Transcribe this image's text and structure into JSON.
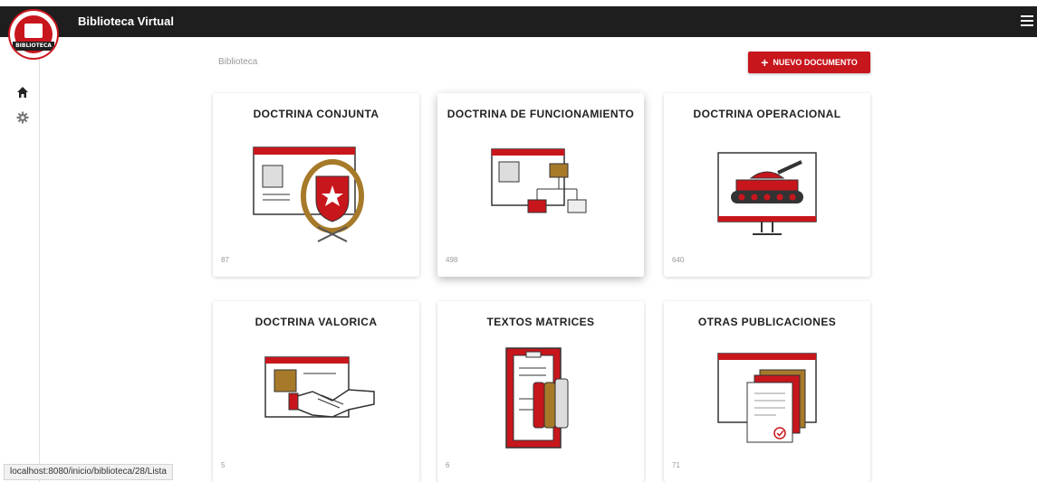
{
  "app": {
    "title": "Biblioteca Virtual",
    "logo_text": "BIBLIOTECA"
  },
  "breadcrumb": "Biblioteca",
  "new_button": {
    "label": "NUEVO DOCUMENTO",
    "icon": "plus-icon"
  },
  "sidebar": {
    "items": [
      {
        "icon": "home-icon"
      },
      {
        "icon": "gear-icon"
      }
    ]
  },
  "status_url": "localhost:8080/inicio/biblioteca/28/Lista",
  "cards": [
    {
      "title": "DOCTRINA CONJUNTA",
      "count": "87",
      "illustration": "seal-document"
    },
    {
      "title": "DOCTRINA DE FUNCIONAMIENTO",
      "count": "498",
      "illustration": "org-chart-document"
    },
    {
      "title": "DOCTRINA OPERACIONAL",
      "count": "640",
      "illustration": "tank-monitor"
    },
    {
      "title": "DOCTRINA VALORICA",
      "count": "5",
      "illustration": "handshake-document"
    },
    {
      "title": "TEXTOS MATRICES",
      "count": "6",
      "illustration": "books-clipboard"
    },
    {
      "title": "OTRAS PUBLICACIONES",
      "count": "71",
      "illustration": "stacked-documents"
    }
  ],
  "colors": {
    "accent": "#c8161d",
    "topbar": "#1e1e1e",
    "gold": "#a77a2a"
  }
}
